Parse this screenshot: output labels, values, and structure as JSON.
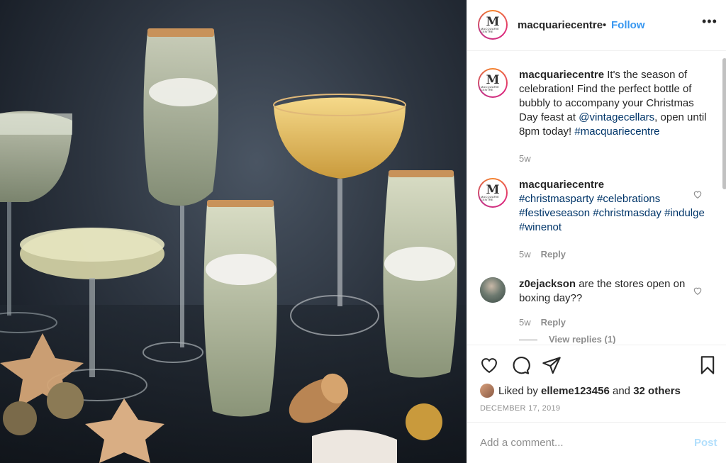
{
  "post": {
    "username": "macquariecentre",
    "follow_label": "Follow",
    "separator": "•",
    "more_label": "•••",
    "avatar_letter": "M",
    "avatar_sub": "MACQUARIE CENTRE"
  },
  "comments": [
    {
      "username": "macquariecentre",
      "text_before": " It's the season of celebration! Find the perfect bottle of bubbly to accompany your Christmas Day feast at ",
      "mention": "@vintagecellars",
      "text_middle": ", open until 8pm today! ",
      "hashtag": "#macquariecentre",
      "time": "5w"
    },
    {
      "username": "macquariecentre",
      "hashtags": "#christmasparty #celebrations #festiveseason #christmasday #indulge #winenot",
      "time": "5w",
      "reply_label": "Reply"
    },
    {
      "username": "z0ejackson",
      "text": " are the stores open on boxing day??",
      "time": "5w",
      "reply_label": "Reply",
      "view_replies": "View replies (1)"
    }
  ],
  "actions": {
    "liked_prefix": "Liked by ",
    "liked_user": "elleme123456",
    "liked_and": " and ",
    "liked_others": "32 others",
    "date": "DECEMBER 17, 2019"
  },
  "add_comment": {
    "placeholder": "Add a comment...",
    "post_label": "Post"
  },
  "colors": {
    "link": "#003569",
    "follow": "#3897f0",
    "muted": "#8e8e8e",
    "post_disabled": "#b2dffc"
  },
  "icons": [
    "heart-icon",
    "comment-icon",
    "share-icon",
    "bookmark-icon",
    "more-options-icon"
  ]
}
